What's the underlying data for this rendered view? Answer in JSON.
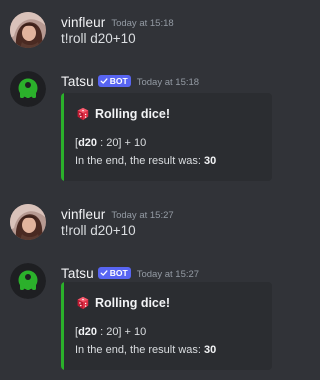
{
  "messages": [
    {
      "username": "vinfleur",
      "timestamp": "Today at 15:18",
      "content": "t!roll d20+10",
      "avatar_icon": "user-photo-avatar"
    },
    {
      "username": "Tatsu",
      "bot_badge": "BOT",
      "timestamp": "Today at 15:18",
      "avatar_icon": "tatsu-logo-avatar",
      "embed": {
        "accent_color": "#2bb02b",
        "title_icon": "red-dice-icon",
        "title": "Rolling dice!",
        "roll_open": "[",
        "roll_die": "d20",
        "roll_rest": " : 20] + 10",
        "result_label": "In the end, the result was: ",
        "result_value": "30"
      }
    },
    {
      "username": "vinfleur",
      "timestamp": "Today at 15:27",
      "content": "t!roll d20+10",
      "avatar_icon": "user-photo-avatar"
    },
    {
      "username": "Tatsu",
      "bot_badge": "BOT",
      "timestamp": "Today at 15:27",
      "avatar_icon": "tatsu-logo-avatar",
      "embed": {
        "accent_color": "#2bb02b",
        "title_icon": "red-dice-icon",
        "title": "Rolling dice!",
        "roll_open": "[",
        "roll_die": "d20",
        "roll_rest": " : 20] + 10",
        "result_label": "In the end, the result was: ",
        "result_value": "30"
      }
    }
  ],
  "colors": {
    "background": "#313338",
    "embed_background": "#2b2d31",
    "bot_badge": "#5865f2",
    "tatsu_green": "#2bb02b",
    "username": "#f2f3f5",
    "timestamp": "#949ba4"
  }
}
